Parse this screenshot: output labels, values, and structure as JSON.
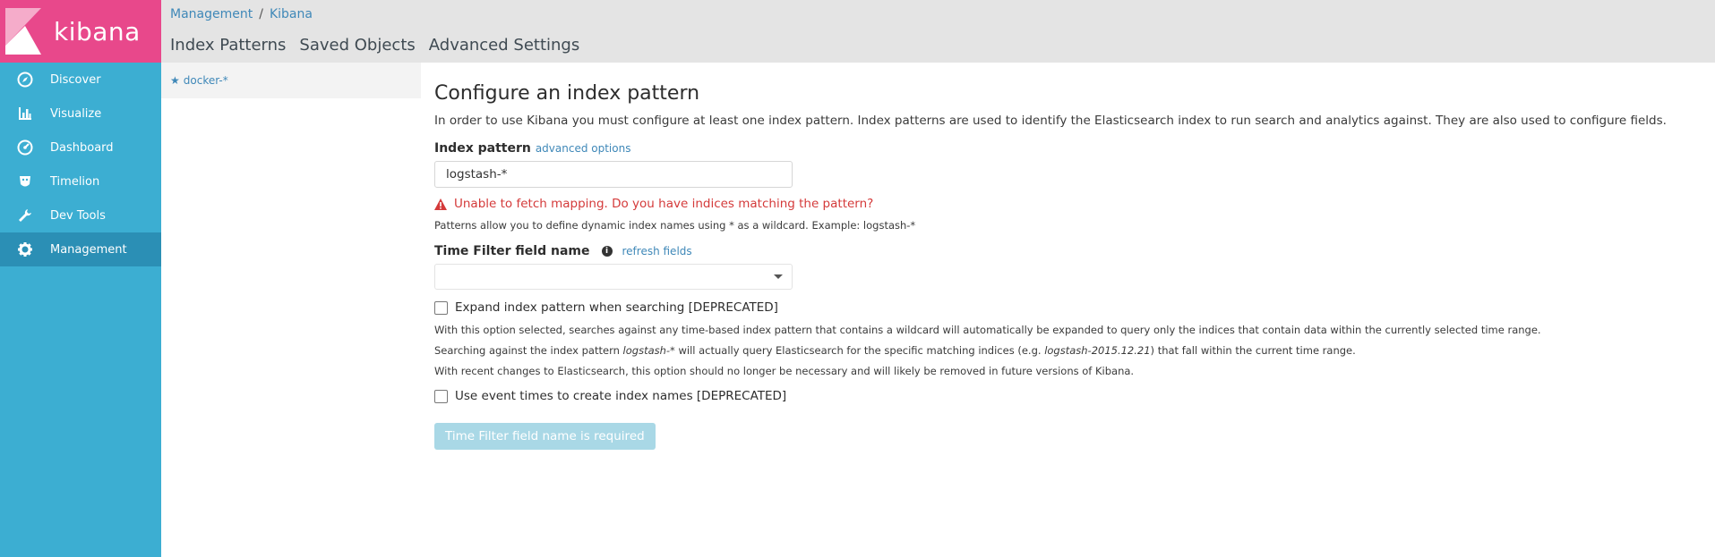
{
  "app": {
    "name": "kibana",
    "brand_color": "#e8488b",
    "sidebar_color": "#3caed2"
  },
  "sidebar": {
    "items": [
      {
        "label": "Discover",
        "icon": "compass-icon"
      },
      {
        "label": "Visualize",
        "icon": "bar-chart-icon"
      },
      {
        "label": "Dashboard",
        "icon": "dashboard-icon"
      },
      {
        "label": "Timelion",
        "icon": "timelion-icon"
      },
      {
        "label": "Dev Tools",
        "icon": "wrench-icon"
      },
      {
        "label": "Management",
        "icon": "gear-icon",
        "active": true
      }
    ]
  },
  "breadcrumb": {
    "root": "Management",
    "separator": "/",
    "current": "Kibana"
  },
  "tabs": [
    "Index Patterns",
    "Saved Objects",
    "Advanced Settings"
  ],
  "index_list": [
    {
      "name": "docker-*",
      "icon": "star-icon"
    }
  ],
  "form": {
    "title": "Configure an index pattern",
    "intro": "In order to use Kibana you must configure at least one index pattern. Index patterns are used to identify the Elasticsearch index to run search and analytics against. They are also used to configure fields.",
    "index_pattern_label": "Index pattern",
    "advanced_options": "advanced options",
    "index_pattern_value": "logstash-*",
    "error": "Unable to fetch mapping. Do you have indices matching the pattern?",
    "hint": "Patterns allow you to define dynamic index names using * as a wildcard. Example: logstash-*",
    "time_filter_label": "Time Filter field name",
    "refresh_fields": "refresh fields",
    "time_filter_value": "",
    "expand_label": "Expand index pattern when searching [DEPRECATED]",
    "expand_desc_1": "With this option selected, searches against any time-based index pattern that contains a wildcard will automatically be expanded to query only the indices that contain data within the currently selected time range.",
    "expand_desc_2_a": "Searching against the index pattern ",
    "expand_desc_2_b": "logstash-*",
    "expand_desc_2_c": " will actually query Elasticsearch for the specific matching indices (e.g. ",
    "expand_desc_2_d": "logstash-2015.12.21",
    "expand_desc_2_e": ") that fall within the current time range.",
    "expand_desc_3": "With recent changes to Elasticsearch, this option should no longer be necessary and will likely be removed in future versions of Kibana.",
    "event_times_label": "Use event times to create index names [DEPRECATED]",
    "submit_label": "Time Filter field name is required"
  }
}
